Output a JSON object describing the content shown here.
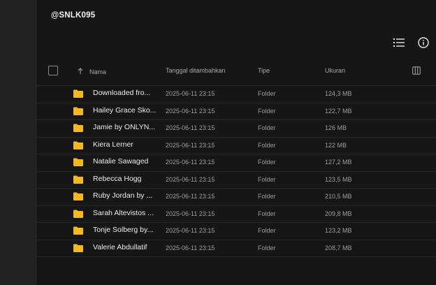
{
  "breadcrumb": {
    "title": "@SNLK095"
  },
  "toolbar": {
    "list_icon": "list-view-icon",
    "info_icon": "info-icon"
  },
  "table": {
    "columns": {
      "name": "Nama",
      "date_added": "Tanggal ditambahkan",
      "type": "Tipe",
      "size": "Ukuran"
    },
    "rows": [
      {
        "name": "Downloaded fro...",
        "date": "2025-06-11 23:15",
        "type": "Folder",
        "size": "124,3 MB"
      },
      {
        "name": "Hailey Grace Sko...",
        "date": "2025-06-11 23:15",
        "type": "Folder",
        "size": "122,7 MB"
      },
      {
        "name": "Jamie by ONLYN...",
        "date": "2025-06-11 23:15",
        "type": "Folder",
        "size": "126 MB"
      },
      {
        "name": "Kiera Lerner",
        "date": "2025-06-11 23:15",
        "type": "Folder",
        "size": "122 MB"
      },
      {
        "name": "Natalie Sawaged",
        "date": "2025-06-11 23:15",
        "type": "Folder",
        "size": "127,2 MB"
      },
      {
        "name": "Rebecca Hogg",
        "date": "2025-06-11 23:15",
        "type": "Folder",
        "size": "123,5 MB"
      },
      {
        "name": "Ruby Jordan by ...",
        "date": "2025-06-11 23:15",
        "type": "Folder",
        "size": "210,5 MB"
      },
      {
        "name": "Sarah Altevistos ...",
        "date": "2025-06-11 23:15",
        "type": "Folder",
        "size": "209,8 MB"
      },
      {
        "name": "Tonje Solberg by...",
        "date": "2025-06-11 23:15",
        "type": "Folder",
        "size": "123,2 MB"
      },
      {
        "name": "Valerie Abdullatif",
        "date": "2025-06-11 23:15",
        "type": "Folder",
        "size": "208,7 MB"
      }
    ]
  },
  "colors": {
    "folder": "#f5b820",
    "background": "#161616",
    "sidebar": "#222222"
  }
}
